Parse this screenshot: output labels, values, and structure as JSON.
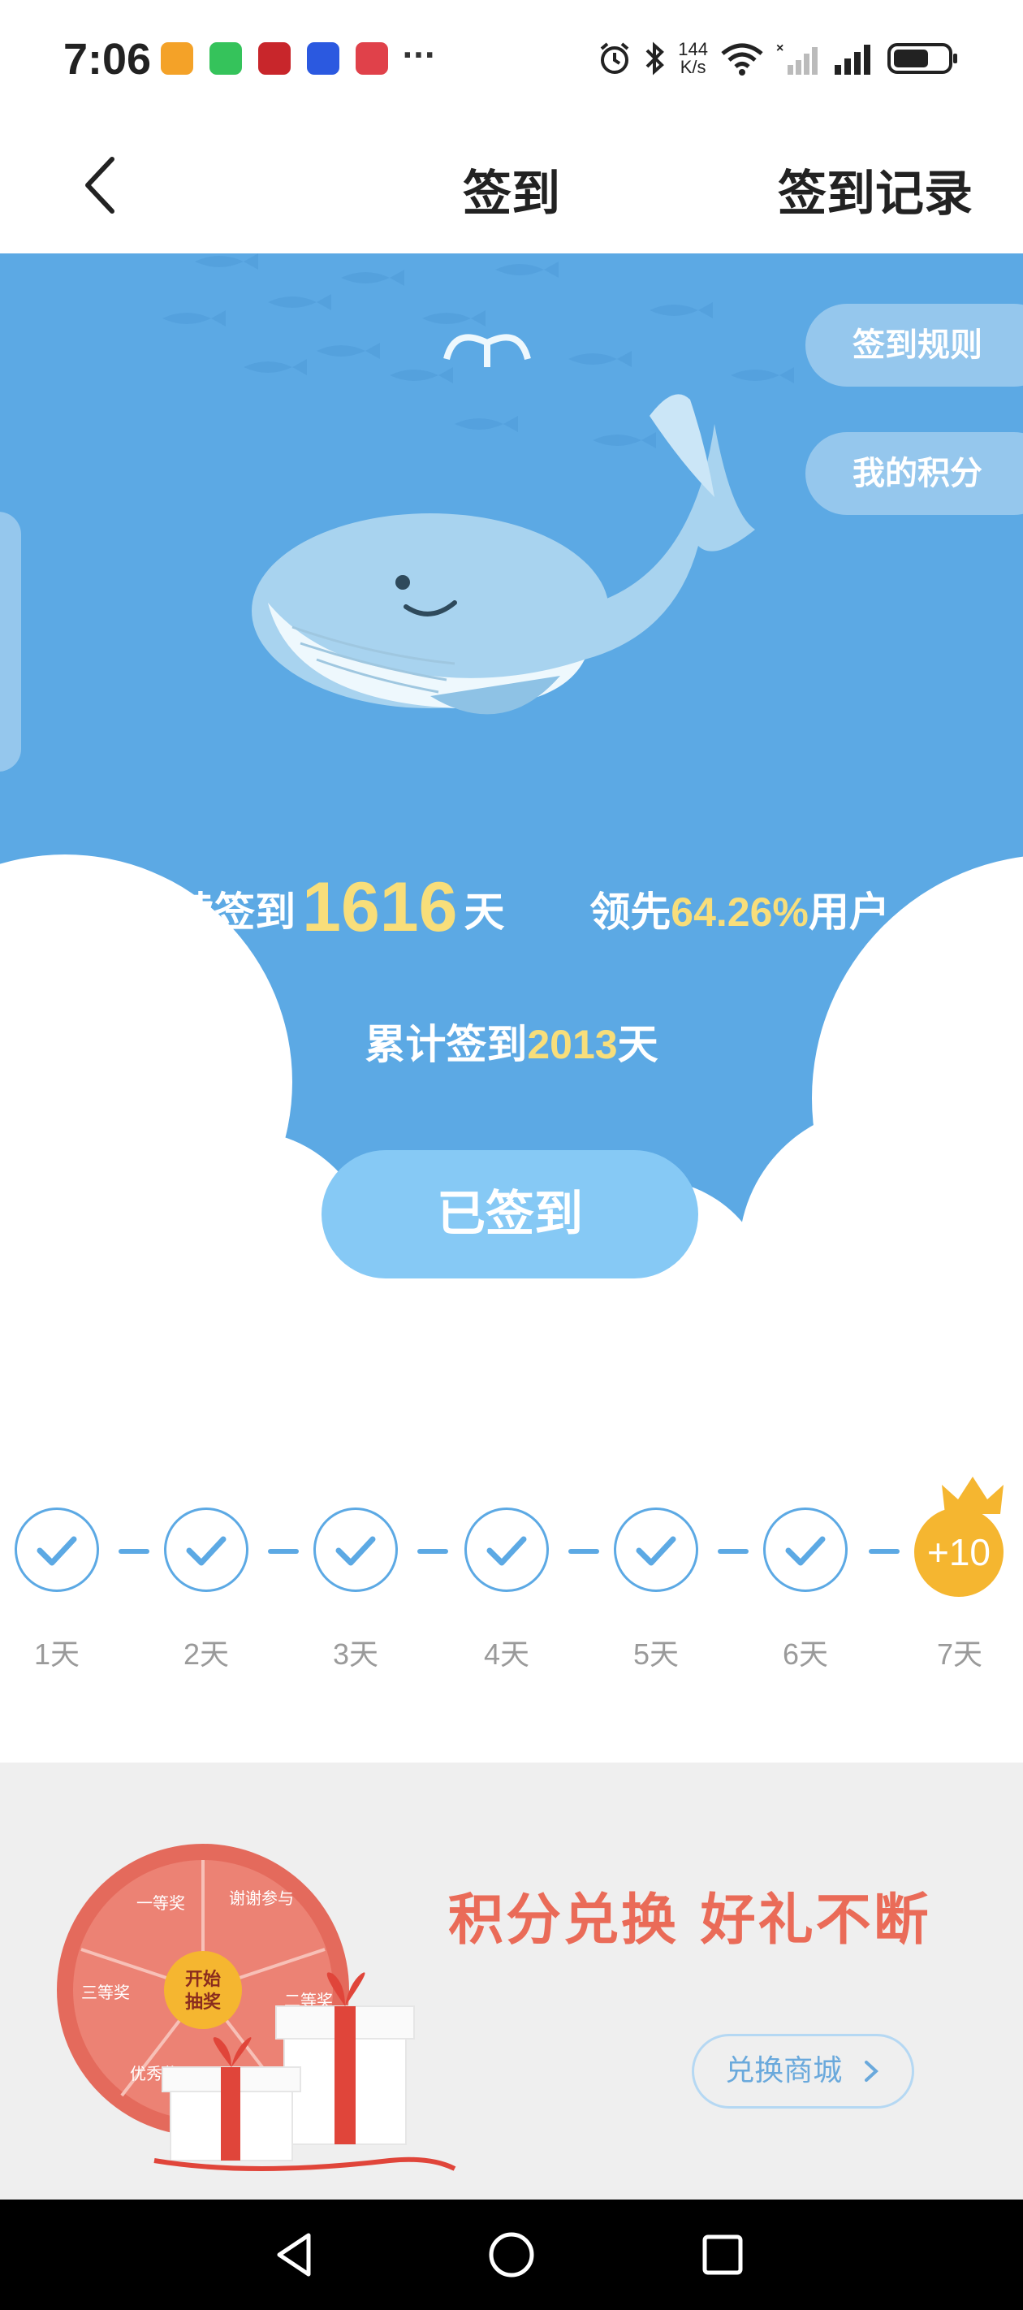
{
  "status_bar": {
    "time": "7:06",
    "more": "···",
    "net_speed_value": "144",
    "net_speed_unit": "K/s",
    "app_icons": [
      "notes-app-icon",
      "wechat-icon",
      "news-app-icon",
      "browser-app-icon",
      "health-app-icon"
    ],
    "indicators": [
      "alarm-icon",
      "bluetooth-icon",
      "wifi-icon",
      "signal-no-service-icon",
      "signal-icon",
      "battery-icon"
    ]
  },
  "nav": {
    "title": "签到",
    "record_label": "签到记录"
  },
  "hero": {
    "rules_label": "签到规则",
    "points_label": "我的积分",
    "streak_prefix": "连续签到",
    "streak_days": "1616",
    "streak_suffix": "天",
    "lead_prefix": "领先",
    "lead_percent": "64.26%",
    "lead_suffix": "用户",
    "total_prefix": "累计签到",
    "total_days": "2013",
    "total_suffix": "天",
    "signed_label": "已签到"
  },
  "week": {
    "days": [
      {
        "label": "1天",
        "checked": true
      },
      {
        "label": "2天",
        "checked": true
      },
      {
        "label": "3天",
        "checked": true
      },
      {
        "label": "4天",
        "checked": true
      },
      {
        "label": "5天",
        "checked": true
      },
      {
        "label": "6天",
        "checked": true
      },
      {
        "label": "7天",
        "checked": false
      }
    ],
    "bonus": "+10"
  },
  "promo": {
    "title": "积分兑换  好礼不断",
    "mall_label": "兑换商城",
    "wheel_center": [
      "开始",
      "抽奖"
    ],
    "wheel_segments": [
      "一等奖",
      "谢谢参与",
      "二等奖",
      "优秀奖",
      "三等奖"
    ]
  },
  "colors": {
    "hero_bg": "#5ca9e4",
    "highlight_yellow": "#f8de7a",
    "bonus_orange": "#f5b630",
    "promo_red": "#ea6b58"
  }
}
